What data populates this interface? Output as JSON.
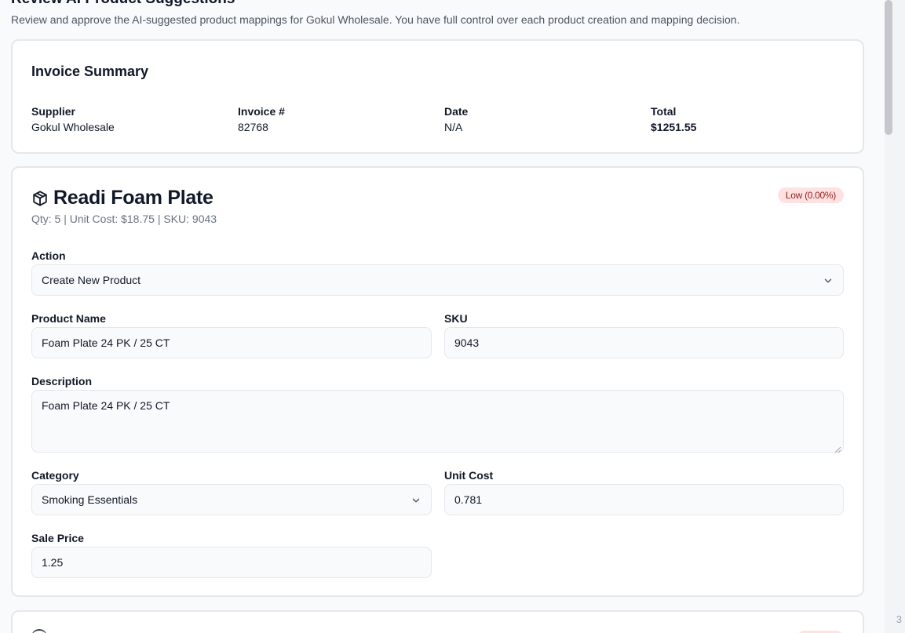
{
  "header": {
    "title": "Review AI Product Suggestions",
    "subtitle": "Review and approve the AI-suggested product mappings for Gokul Wholesale. You have full control over each product creation and mapping decision."
  },
  "invoice_summary": {
    "title": "Invoice Summary",
    "supplier_label": "Supplier",
    "supplier_value": "Gokul Wholesale",
    "invoice_label": "Invoice #",
    "invoice_value": "82768",
    "date_label": "Date",
    "date_value": "N/A",
    "total_label": "Total",
    "total_value": "$1251.55"
  },
  "product": {
    "icon": "box-icon",
    "title": "Readi Foam Plate",
    "meta": "Qty: 5 | Unit Cost: $18.75 | SKU: 9043",
    "confidence_badge": "Low (0.00%)",
    "badge_color": "#fee2e2",
    "action_label": "Action",
    "action_value": "Create New Product",
    "product_name_label": "Product Name",
    "product_name_value": "Foam Plate 24 PK / 25 CT",
    "sku_label": "SKU",
    "sku_value": "9043",
    "description_label": "Description",
    "description_value": "Foam Plate 24 PK / 25 CT",
    "category_label": "Category",
    "category_value": "Smoking Essentials",
    "unit_cost_label": "Unit Cost",
    "unit_cost_value": "0.781",
    "sale_price_label": "Sale Price",
    "sale_price_value": "1.25"
  },
  "corner_text": "3"
}
